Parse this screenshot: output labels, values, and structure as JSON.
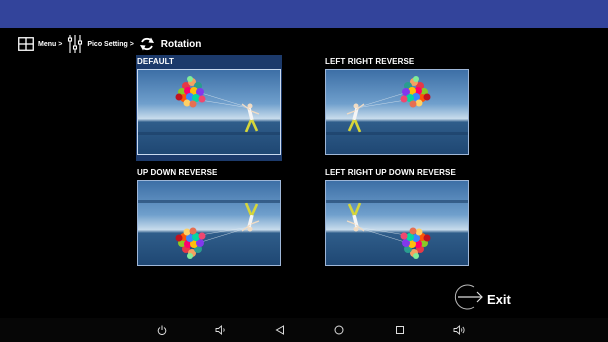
{
  "breadcrumb": {
    "menu_icon": "grid-icon",
    "menu_label": "Menu >",
    "setting_icon": "sliders-icon",
    "setting_label": "Pico Setting >",
    "rotation_icon": "rotate-icon",
    "rotation_label": "Rotation"
  },
  "options": [
    {
      "label": "DEFAULT",
      "selected": true
    },
    {
      "label": "LEFT RIGHT REVERSE",
      "selected": false
    },
    {
      "label": "UP DOWN REVERSE",
      "selected": false
    },
    {
      "label": "LEFT RIGHT UP DOWN REVERSE",
      "selected": false
    }
  ],
  "exit": {
    "label": "Exit",
    "icon": "arrow-right-circle-icon"
  },
  "navbar": [
    "power-icon",
    "volume-down-icon",
    "back-icon",
    "home-icon",
    "recents-icon",
    "volume-up-icon"
  ],
  "colors": {
    "statusbar": "#33449b",
    "selected": "#1c3a6b",
    "background": "#000000"
  }
}
